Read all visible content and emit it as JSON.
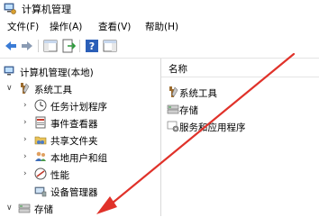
{
  "window": {
    "title": "计算机管理"
  },
  "menu": [
    "文件(F)",
    "操作(A)",
    "查看(V)",
    "帮助(H)"
  ],
  "tree": {
    "root": "计算机管理(本地)",
    "system_tools": "系统工具",
    "items": [
      "任务计划程序",
      "事件查看器",
      "共享文件夹",
      "本地用户和组",
      "性能",
      "设备管理器"
    ],
    "storage": "存储"
  },
  "list": {
    "column_header": "名称",
    "items": [
      "系统工具",
      "存储",
      "服务和应用程序"
    ]
  },
  "colors": {
    "arrow": "#e0322a"
  }
}
